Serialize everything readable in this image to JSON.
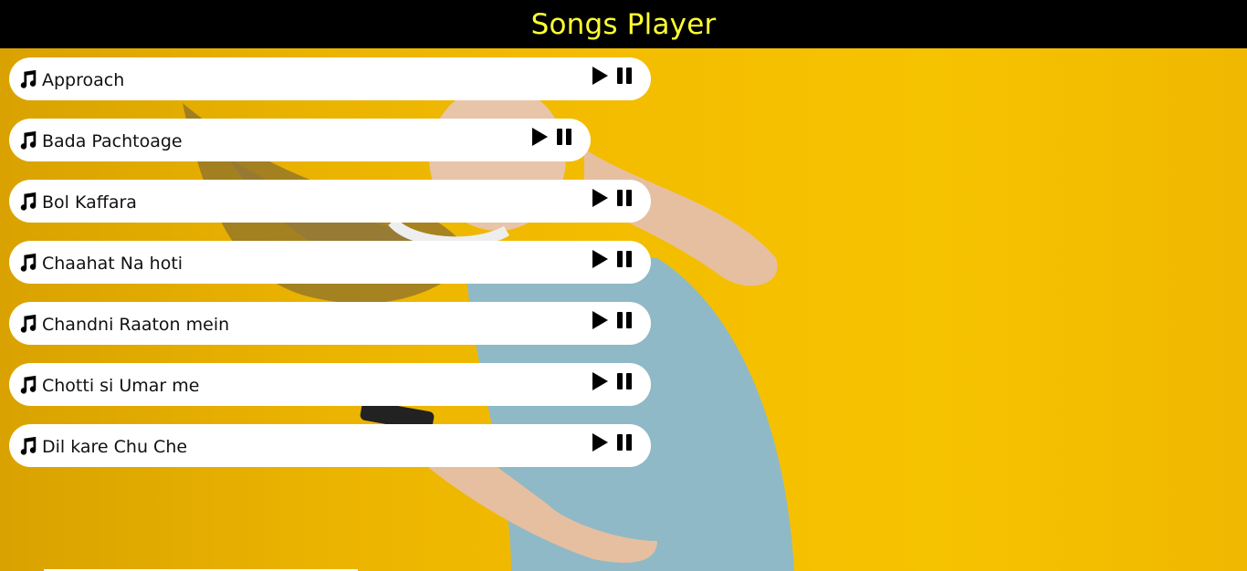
{
  "header": {
    "title": "Songs Player"
  },
  "songs": [
    {
      "name": "Approach"
    },
    {
      "name": "Bada Pachtoage"
    },
    {
      "name": "Bol Kaffara"
    },
    {
      "name": "Chaahat Na hoti"
    },
    {
      "name": "Chandni Raaton mein"
    },
    {
      "name": "Chotti si Umar me"
    },
    {
      "name": "Dil kare Chu Che"
    }
  ],
  "icons": {
    "note": "music-note-icon",
    "play": "play-icon",
    "pause": "pause-icon"
  },
  "colors": {
    "header_bg": "#000000",
    "title": "#ffff33",
    "background": "#f2b705"
  }
}
